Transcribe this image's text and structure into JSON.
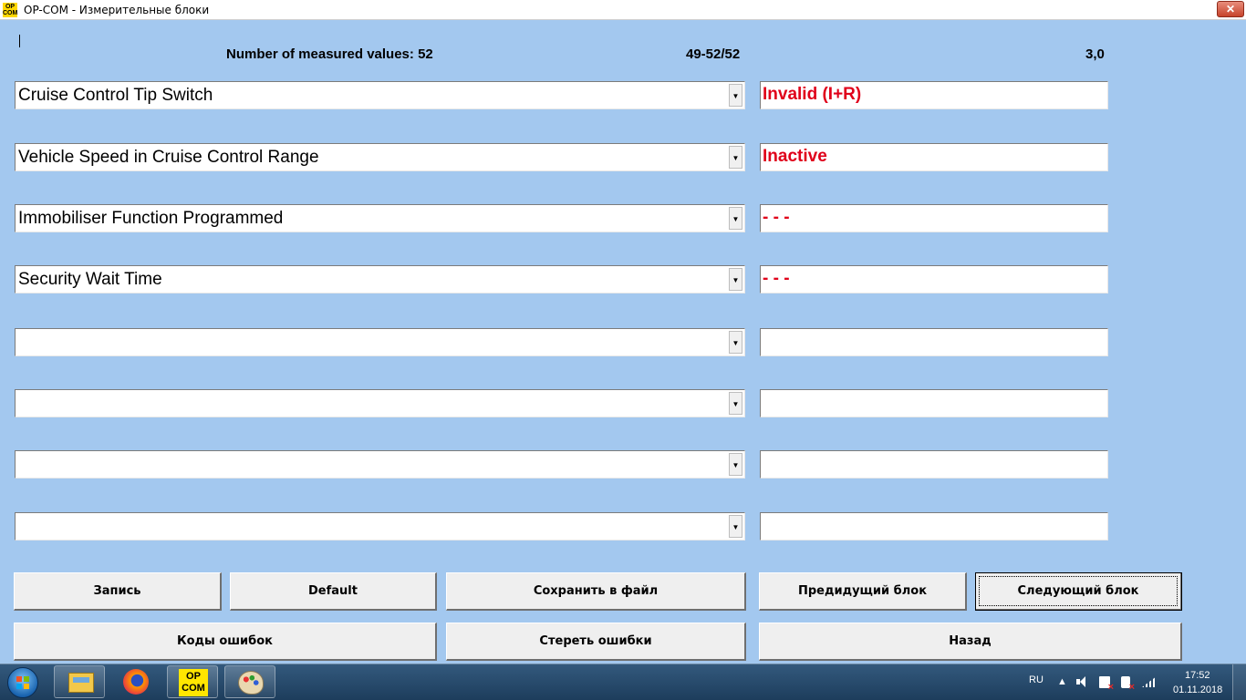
{
  "window": {
    "icon_text": "OP COM",
    "title": "OP-COM - Измерительные блоки",
    "close_glyph": "✕"
  },
  "header": {
    "measured_count": "Number of measured values: 52",
    "range": "49-52/52",
    "version": "3,0"
  },
  "rows": [
    {
      "parameter": "Cruise Control Tip Switch",
      "value": "Invalid (I+R)"
    },
    {
      "parameter": "Vehicle Speed in Cruise Control Range",
      "value": "Inactive"
    },
    {
      "parameter": "Immobiliser Function Programmed",
      "value": "- - -"
    },
    {
      "parameter": "Security Wait Time",
      "value": "- - -"
    },
    {
      "parameter": "",
      "value": ""
    },
    {
      "parameter": "",
      "value": ""
    },
    {
      "parameter": "",
      "value": ""
    },
    {
      "parameter": "",
      "value": ""
    }
  ],
  "buttons": {
    "record": "Запись",
    "default": "Default",
    "save_to_file": "Сохранить в файл",
    "previous_block": "Предидущий блок",
    "next_block": "Следующий блок",
    "error_codes": "Коды ошибок",
    "clear_errors": "Стереть ошибки",
    "back": "Назад"
  },
  "taskbar": {
    "pinned_apps": [
      "windows-explorer",
      "firefox",
      "op-com",
      "paint"
    ],
    "opcom_label": "OP COM",
    "language": "RU",
    "tray_chevron": "▲",
    "time": "17:52",
    "date": "01.11.2018"
  },
  "colors": {
    "background": "#a3c8ef",
    "value_text": "#e0001a"
  },
  "icons": {
    "dropdown_arrow": "▼"
  }
}
